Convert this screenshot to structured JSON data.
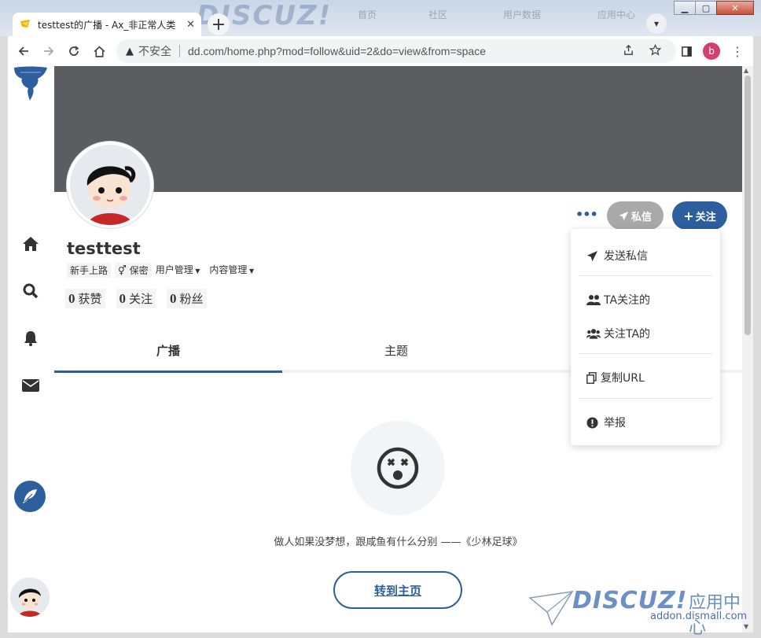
{
  "browser": {
    "tab_title": "testtest的广播 - Ax_非正常人类",
    "insecure_label": "不安全",
    "url": "dd.com/home.php?mod=follow&uid=2&do=view&from=space",
    "profile_initial": "b",
    "bg_logo": "DISCUZ!",
    "bg_menu": [
      "首页",
      "社区",
      "用户数据",
      "应用中心"
    ]
  },
  "profile": {
    "username": "testtest",
    "group_tag": "新手上路",
    "gender_tag": "保密",
    "user_mgmt": "用户管理",
    "content_mgmt": "内容管理",
    "stats": [
      {
        "count": "0",
        "label": "获赞"
      },
      {
        "count": "0",
        "label": "关注"
      },
      {
        "count": "0",
        "label": "粉丝"
      }
    ],
    "pm_button": "私信",
    "follow_button": "关注"
  },
  "tabs": [
    {
      "label": "广播"
    },
    {
      "label": "主题"
    }
  ],
  "menu": {
    "send_pm": "发送私信",
    "following": "TA关注的",
    "followers": "关注TA的",
    "copy_url": "复制URL",
    "report": "举报"
  },
  "empty": {
    "quote": "做人如果没梦想，跟咸鱼有什么分别 ——《少林足球》",
    "home_button": "转到主页"
  },
  "watermark": {
    "brand": "DISCUZ!",
    "app_center": "应用中心",
    "domain": "addon.dismall.com"
  },
  "colors": {
    "accent": "#2d5f9e",
    "cover": "#5b5d61",
    "pm_button": "#a9a9a9"
  }
}
